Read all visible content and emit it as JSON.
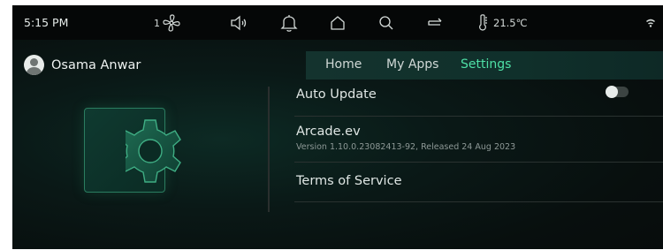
{
  "status_bar": {
    "time": "5:15 PM",
    "fan_level": "1",
    "temperature": "21.5℃",
    "icons": [
      "fan-icon",
      "volume-icon",
      "bell-icon",
      "home-icon",
      "search-icon",
      "repeat-icon",
      "thermometer-icon",
      "wifi-icon"
    ]
  },
  "user": {
    "name": "Osama  Anwar"
  },
  "nav": {
    "tabs": [
      {
        "label": "Home",
        "active": false
      },
      {
        "label": "My Apps",
        "active": false
      },
      {
        "label": "Settings",
        "active": true
      }
    ]
  },
  "settings": {
    "auto_update": {
      "label": "Auto Update",
      "enabled": false
    },
    "app": {
      "name": "Arcade.ev",
      "version_info": "Version 1.10.0.23082413-92, Released 24 Aug 2023"
    },
    "terms": {
      "label": "Terms of Service"
    }
  },
  "colors": {
    "accent": "#4ee0a6",
    "background": "#0a1917",
    "status_bar": "#050707",
    "nav_bar": "#14332e"
  }
}
